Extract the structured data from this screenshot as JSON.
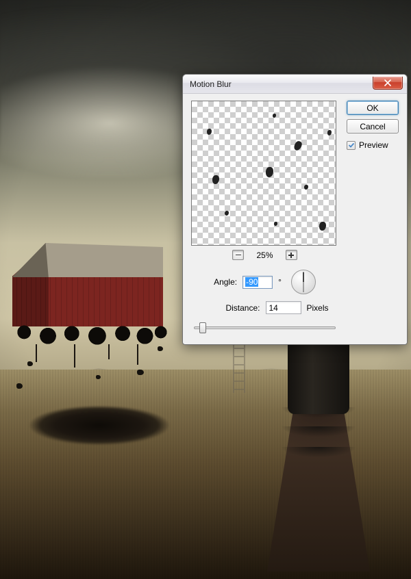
{
  "dialog": {
    "title": "Motion Blur",
    "ok_label": "OK",
    "cancel_label": "Cancel",
    "preview_label": "Preview",
    "preview_checked": true,
    "zoom_percent": "25%",
    "angle_label": "Angle:",
    "angle_value": "-90",
    "angle_unit": "°",
    "distance_label": "Distance:",
    "distance_value": "14",
    "distance_unit": "Pixels",
    "distance_slider_pos_pct": 4
  },
  "colors": {
    "close_red": "#c9402c",
    "focus_blue": "#3c7fb1",
    "selection_blue": "#3399ff",
    "barn_red": "#7c2520"
  }
}
